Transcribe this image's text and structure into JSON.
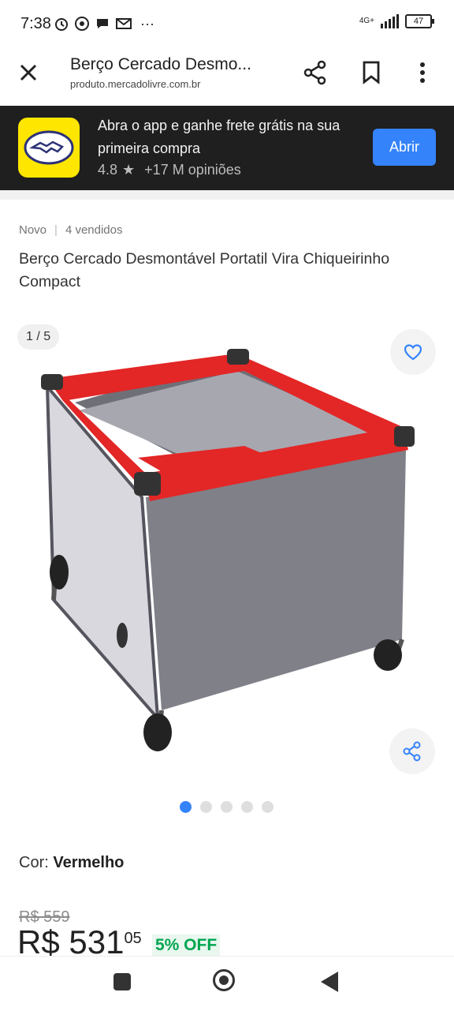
{
  "status_bar": {
    "time": "7:38",
    "notification_icons": [
      "alarm-icon",
      "whatsapp-icon",
      "chat-icon",
      "gmail-icon",
      "more-dots-icon"
    ],
    "more": "···",
    "network": "4G+",
    "battery": "47"
  },
  "browser": {
    "page_title": "Berço Cercado Desmo...",
    "url": "produto.mercadolivre.com.br"
  },
  "app_banner": {
    "message": "Abra o app e ganhe frete grátis na sua primeira compra",
    "rating": "4.8",
    "star": "★",
    "reviews": "+17 M opiniões",
    "open_button": "Abrir"
  },
  "product": {
    "condition": "Novo",
    "separator": "|",
    "sold": "4 vendidos",
    "title": "Berço Cercado Desmontável Portatil Vira Chiqueirinho Compact",
    "image_counter": "1 / 5",
    "gallery_total": 5,
    "gallery_active": 1,
    "color_label": "Cor:",
    "color_value": "Vermelho",
    "old_price": "R$ 559",
    "price_main": "R$ 531",
    "price_cents": "05",
    "discount": "5% OFF"
  },
  "colors": {
    "accent_blue": "#3483fa",
    "brand_yellow": "#ffe600",
    "discount_green": "#00a650",
    "crib_red": "#e32626",
    "crib_gray": "#7a7a85"
  }
}
